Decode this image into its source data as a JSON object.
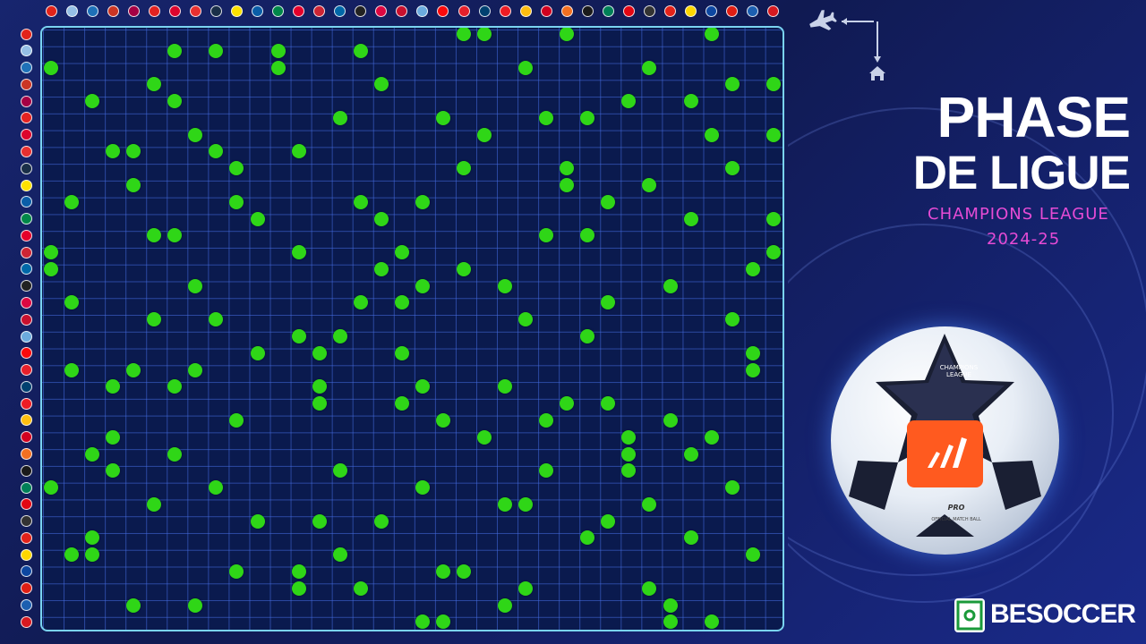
{
  "title": {
    "line1": "PHASE",
    "line2": "DE LIGUE"
  },
  "subtitle": {
    "competition": "CHAMPIONS LEAGUE",
    "season": "2024-25"
  },
  "brand": {
    "name": "BESOCCER"
  },
  "ball_text": {
    "cl_logo": "CHAMPIONS LEAGUE",
    "pro": "PRO",
    "official": "OFFICIAL MATCH BALL"
  },
  "icons": {
    "away": "airplane-icon",
    "home": "home-icon"
  },
  "colors": {
    "match_dot": "#2fd617",
    "grid_line": "#466ee6",
    "board_border": "#7ad3f0",
    "board_background": "#0a1a4e",
    "title": "#ffffff",
    "subtitle": "#e64bd5"
  },
  "teams": [
    {
      "id": "arsenal",
      "color": "#e2231a"
    },
    {
      "id": "aston-villa",
      "color": "#95bfe5"
    },
    {
      "id": "atalanta",
      "color": "#1e71b8"
    },
    {
      "id": "atletico-madrid",
      "color": "#cb3524"
    },
    {
      "id": "barcelona",
      "color": "#a50044"
    },
    {
      "id": "bayer-leverkusen",
      "color": "#e32221"
    },
    {
      "id": "bayern-munich",
      "color": "#dc052d"
    },
    {
      "id": "benfica",
      "color": "#e83030"
    },
    {
      "id": "bologna",
      "color": "#1a2f48"
    },
    {
      "id": "borussia-dortmund",
      "color": "#fde100"
    },
    {
      "id": "club-brugge",
      "color": "#0a5ea8"
    },
    {
      "id": "celtic",
      "color": "#018749"
    },
    {
      "id": "feyenoord",
      "color": "#e4002b"
    },
    {
      "id": "girona",
      "color": "#cd2534"
    },
    {
      "id": "inter",
      "color": "#0068a8"
    },
    {
      "id": "juventus",
      "color": "#222222"
    },
    {
      "id": "rb-leipzig",
      "color": "#dd0741"
    },
    {
      "id": "liverpool",
      "color": "#c8102e"
    },
    {
      "id": "manchester-city",
      "color": "#6cabdd"
    },
    {
      "id": "ac-milan",
      "color": "#fb090b"
    },
    {
      "id": "monaco",
      "color": "#e7202b"
    },
    {
      "id": "paris-saint-germain",
      "color": "#004170"
    },
    {
      "id": "psv",
      "color": "#ed1c24"
    },
    {
      "id": "real-madrid",
      "color": "#febe10"
    },
    {
      "id": "red-bull-salzburg",
      "color": "#d1001f"
    },
    {
      "id": "shakhtar-donetsk",
      "color": "#f37021"
    },
    {
      "id": "sparta-praha",
      "color": "#1a1a1a"
    },
    {
      "id": "sporting-cp",
      "color": "#008057"
    },
    {
      "id": "brest",
      "color": "#e30613"
    },
    {
      "id": "sturm-graz",
      "color": "#333333"
    },
    {
      "id": "stuttgart",
      "color": "#e32219"
    },
    {
      "id": "young-boys",
      "color": "#fdd700"
    },
    {
      "id": "dinamo-zagreb",
      "color": "#0d47a1"
    },
    {
      "id": "lille",
      "color": "#e01e13"
    },
    {
      "id": "slovan-bratislava",
      "color": "#1c5fb0"
    },
    {
      "id": "crvena-zvezda",
      "color": "#d71920"
    }
  ],
  "matches": [
    [
      0,
      20
    ],
    [
      0,
      21
    ],
    [
      0,
      25
    ],
    [
      0,
      32
    ],
    [
      1,
      6
    ],
    [
      1,
      8
    ],
    [
      1,
      11
    ],
    [
      1,
      15
    ],
    [
      2,
      0
    ],
    [
      2,
      11
    ],
    [
      2,
      23
    ],
    [
      2,
      29
    ],
    [
      3,
      5
    ],
    [
      3,
      16
    ],
    [
      3,
      33
    ],
    [
      3,
      35
    ],
    [
      4,
      2
    ],
    [
      4,
      6
    ],
    [
      4,
      28
    ],
    [
      4,
      31
    ],
    [
      5,
      14
    ],
    [
      5,
      19
    ],
    [
      5,
      24
    ],
    [
      5,
      26
    ],
    [
      6,
      7
    ],
    [
      6,
      21
    ],
    [
      6,
      32
    ],
    [
      6,
      35
    ],
    [
      7,
      3
    ],
    [
      7,
      4
    ],
    [
      7,
      8
    ],
    [
      7,
      12
    ],
    [
      8,
      9
    ],
    [
      8,
      20
    ],
    [
      8,
      25
    ],
    [
      8,
      33
    ],
    [
      9,
      4
    ],
    [
      9,
      25
    ],
    [
      9,
      29
    ],
    [
      10,
      1
    ],
    [
      10,
      9
    ],
    [
      10,
      15
    ],
    [
      10,
      18
    ],
    [
      10,
      27
    ],
    [
      11,
      10
    ],
    [
      11,
      16
    ],
    [
      11,
      31
    ],
    [
      11,
      35
    ],
    [
      12,
      5
    ],
    [
      12,
      6
    ],
    [
      12,
      24
    ],
    [
      12,
      26
    ],
    [
      13,
      0
    ],
    [
      13,
      12
    ],
    [
      13,
      17
    ],
    [
      13,
      35
    ],
    [
      14,
      0
    ],
    [
      14,
      16
    ],
    [
      14,
      20
    ],
    [
      14,
      34
    ],
    [
      15,
      7
    ],
    [
      15,
      18
    ],
    [
      15,
      22
    ],
    [
      15,
      30
    ],
    [
      16,
      1
    ],
    [
      16,
      15
    ],
    [
      16,
      17
    ],
    [
      16,
      27
    ],
    [
      17,
      5
    ],
    [
      17,
      8
    ],
    [
      17,
      23
    ],
    [
      17,
      33
    ],
    [
      18,
      12
    ],
    [
      18,
      14
    ],
    [
      18,
      26
    ],
    [
      19,
      10
    ],
    [
      19,
      13
    ],
    [
      19,
      17
    ],
    [
      19,
      34
    ],
    [
      20,
      1
    ],
    [
      20,
      4
    ],
    [
      20,
      7
    ],
    [
      20,
      34
    ],
    [
      21,
      3
    ],
    [
      21,
      6
    ],
    [
      21,
      13
    ],
    [
      21,
      18
    ],
    [
      21,
      22
    ],
    [
      22,
      13
    ],
    [
      22,
      17
    ],
    [
      22,
      25
    ],
    [
      22,
      27
    ],
    [
      23,
      9
    ],
    [
      23,
      19
    ],
    [
      23,
      24
    ],
    [
      23,
      30
    ],
    [
      24,
      3
    ],
    [
      24,
      21
    ],
    [
      24,
      28
    ],
    [
      24,
      32
    ],
    [
      25,
      2
    ],
    [
      25,
      6
    ],
    [
      25,
      28
    ],
    [
      25,
      31
    ],
    [
      26,
      3
    ],
    [
      26,
      14
    ],
    [
      26,
      24
    ],
    [
      26,
      28
    ],
    [
      27,
      0
    ],
    [
      27,
      8
    ],
    [
      27,
      18
    ],
    [
      27,
      33
    ],
    [
      28,
      5
    ],
    [
      28,
      22
    ],
    [
      28,
      23
    ],
    [
      28,
      29
    ],
    [
      29,
      10
    ],
    [
      29,
      13
    ],
    [
      29,
      16
    ],
    [
      29,
      27
    ],
    [
      30,
      2
    ],
    [
      30,
      26
    ],
    [
      30,
      31
    ],
    [
      31,
      1
    ],
    [
      31,
      2
    ],
    [
      31,
      14
    ],
    [
      31,
      34
    ],
    [
      32,
      9
    ],
    [
      32,
      12
    ],
    [
      32,
      19
    ],
    [
      32,
      20
    ],
    [
      33,
      12
    ],
    [
      33,
      15
    ],
    [
      33,
      23
    ],
    [
      33,
      29
    ],
    [
      34,
      4
    ],
    [
      34,
      7
    ],
    [
      34,
      22
    ],
    [
      34,
      30
    ],
    [
      35,
      18
    ],
    [
      35,
      19
    ],
    [
      35,
      30
    ],
    [
      35,
      32
    ]
  ]
}
